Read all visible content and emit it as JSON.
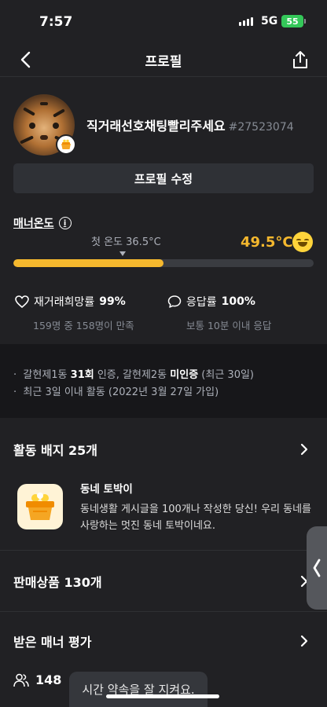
{
  "status_bar": {
    "time": "7:57",
    "network": "5G",
    "battery": "55"
  },
  "header": {
    "title": "프로필",
    "back_icon": "chevron-left-icon",
    "share_icon": "share-icon"
  },
  "profile": {
    "nickname": "직거래선호채팅빨리주세요",
    "user_id": "#27523074",
    "edit_button": "프로필 수정"
  },
  "manner": {
    "label": "매너온도",
    "first_temp": "첫 온도 36.5°C",
    "temperature": "49.5°C",
    "progress": 0.5,
    "accent_color": "#f5b82e"
  },
  "stats": {
    "rebuy": {
      "label": "재거래희망률",
      "value": "99%",
      "sub": "159명 중 158명이 만족"
    },
    "response": {
      "label": "응답률",
      "value": "100%",
      "sub": "보통 10분 이내 응답"
    }
  },
  "info": {
    "line1_prefix": "갈현제1동 ",
    "line1_count": "31회",
    "line1_mid": " 인증, 갈현제2동 ",
    "line1_status": "미인증",
    "line1_suffix": " (최근 30일)",
    "line2": "최근 3일 이내 활동 (2022년 3월 27일 가입)"
  },
  "badges": {
    "title": "활동 배지 25개",
    "featured": {
      "name": "동네 토박이",
      "description": "동네생활 게시글을 100개나 작성한 당신! 우리 동네를 사랑하는 멋진 동네 토박이네요."
    }
  },
  "sales": {
    "title": "판매상품 130개"
  },
  "reviews": {
    "title": "받은 매너 평가",
    "count": "148",
    "top_review": "시간 약속을 잘 지켜요."
  }
}
